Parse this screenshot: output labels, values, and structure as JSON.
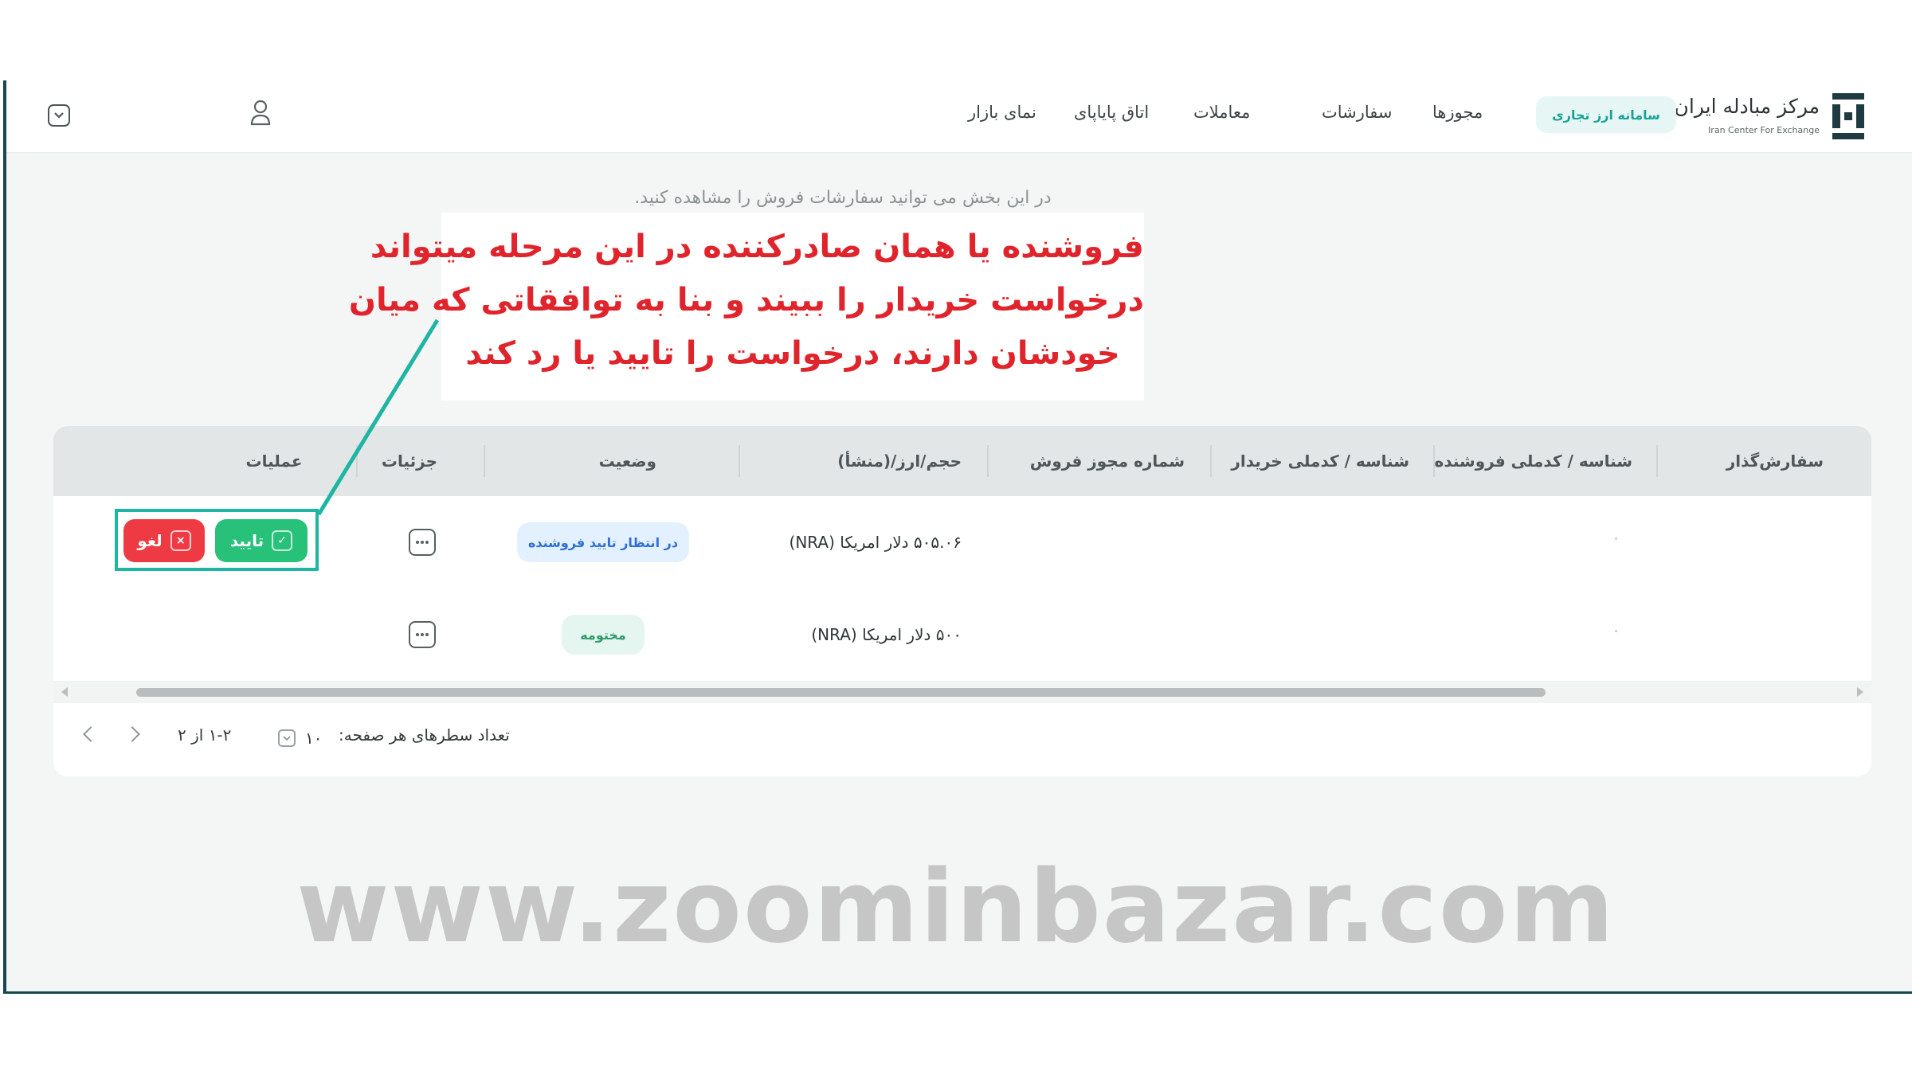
{
  "brand": {
    "name_fa": "مرکز مبادله ایران",
    "name_en": "Iran Center For Exchange"
  },
  "nav": {
    "forex_system": "سامانه ارز تجاری",
    "items": [
      "مجوزها",
      "سفارشات",
      "معاملات",
      "اتاق پایاپای",
      "نمای بازار"
    ]
  },
  "intro_text": "در این بخش می توانید سفارشات فروش را مشاهده کنید.",
  "callout": {
    "lines": [
      "فروشنده یا همان صادرکننده در این مرحله میتواند",
      "درخواست خریدار را ببیند و بنا به توافقاتی که میان",
      "خودشان دارند، درخواست را تایید یا رد کند"
    ],
    "accent_color": "#e0242c",
    "line_color": "#1fb5a3"
  },
  "table": {
    "headers": {
      "orderer": "سفارش‌گذار",
      "seller_id": "شناسه / کدملی فروشنده",
      "buyer_id": "شناسه / کدملی خریدار",
      "permit_no": "شماره مجوز فروش",
      "volume": "حجم/ارز/(منشأ)",
      "status": "وضعیت",
      "details": "جزئیات",
      "operations": "عملیات"
    },
    "rows": [
      {
        "volume": "۵۰۵.۰۶ دلار امریکا (NRA)",
        "status": "در انتظار تایید فروشنده",
        "status_color": "#2f6fd6"
      },
      {
        "volume": "۵۰۰ دلار امریکا (NRA)",
        "status": "مختومه",
        "status_color": "#2f9a6c"
      }
    ],
    "actions": {
      "approve": "تایید",
      "reject": "لغو",
      "approve_color": "#28c17a",
      "reject_color": "#ee3b43"
    }
  },
  "pagination": {
    "rows_per_page_label": "تعداد سطرهای هر صفحه:",
    "rows_per_page_value": "۱۰",
    "range": "۱-۲ از ۲"
  },
  "watermark": "www.zoominbazar.com"
}
